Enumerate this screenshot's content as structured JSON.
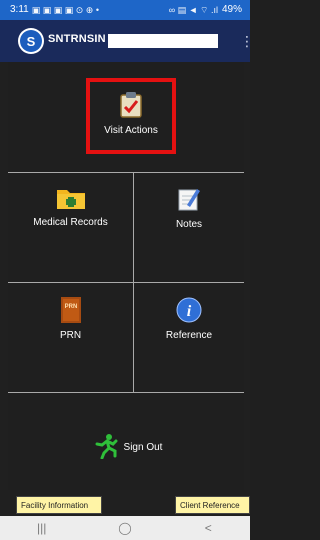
{
  "status_bar": {
    "time": "3:11",
    "left_icons": "▣ ▣ ▣ ▣ ⊙ ⊕ •",
    "right_icons": "∞ ▤ ◄ ⌔ .ıl",
    "battery": "49%"
  },
  "app_bar": {
    "logo_letter": "S",
    "title": "SNTRNSIN -",
    "overflow_glyph": "⋮"
  },
  "tiles": {
    "visit_actions": "Visit Actions",
    "medical_records": "Medical Records",
    "notes": "Notes",
    "prn": "PRN",
    "prn_icon_text": "PRN",
    "reference": "Reference",
    "info_glyph": "i",
    "sign_out": "Sign Out"
  },
  "bottom": {
    "facility_information": "Facility Information",
    "client_reference": "Client Reference"
  },
  "nav": {
    "recent": "|||",
    "home": "◯",
    "back": "<"
  },
  "colors": {
    "status_bar": "#1e66c8",
    "app_bar": "#1a2a5b",
    "background": "#202020",
    "highlight_border": "#e41111",
    "bottom_button": "#fff4a6"
  }
}
